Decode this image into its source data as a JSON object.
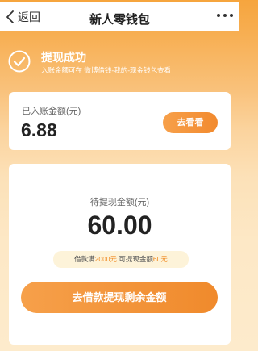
{
  "navbar": {
    "back_label": "返回",
    "title": "新人零钱包"
  },
  "success": {
    "title": "提现成功",
    "subtitle": "入账金额可在 微博借钱-我的-现金钱包查看"
  },
  "credited_card": {
    "label": "已入账金额(元)",
    "amount": "6.88",
    "button_label": "去看看"
  },
  "pending_card": {
    "label": "待提现金额(元)",
    "amount": "60.00",
    "hint": {
      "prefix": "借款满",
      "loan_amount": "2000元",
      "middle": " 可提现金额",
      "withdraw_amount": "60元"
    },
    "cta_label": "去借款提现剩余金额"
  },
  "colors": {
    "accent": "#f28a2e",
    "highlight_text": "#f08a22"
  },
  "icons": [
    "back-chevron-icon",
    "more-dots-icon",
    "check-circle-icon"
  ]
}
